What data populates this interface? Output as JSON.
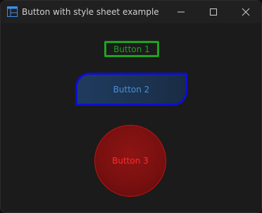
{
  "window": {
    "title": "Button with style sheet example",
    "icon": "app-window-icon",
    "controls": {
      "minimize_icon": "minimize-icon",
      "maximize_icon": "maximize-icon",
      "close_icon": "close-icon"
    }
  },
  "buttons": {
    "button1": {
      "label": "Button 1",
      "border_color": "#1fa31f",
      "text_color": "#1fa31f"
    },
    "button2": {
      "label": "Button 2",
      "border_color": "#0d0ed6",
      "text_color": "#4a8fd8"
    },
    "button3": {
      "label": "Button 3",
      "border_color": "#c31313",
      "text_color": "#ff2a2a"
    }
  },
  "theme": {
    "window_bg": "#1b1b1b",
    "titlebar_bg": "#202020",
    "accent_icon": "#3c8ee6"
  }
}
